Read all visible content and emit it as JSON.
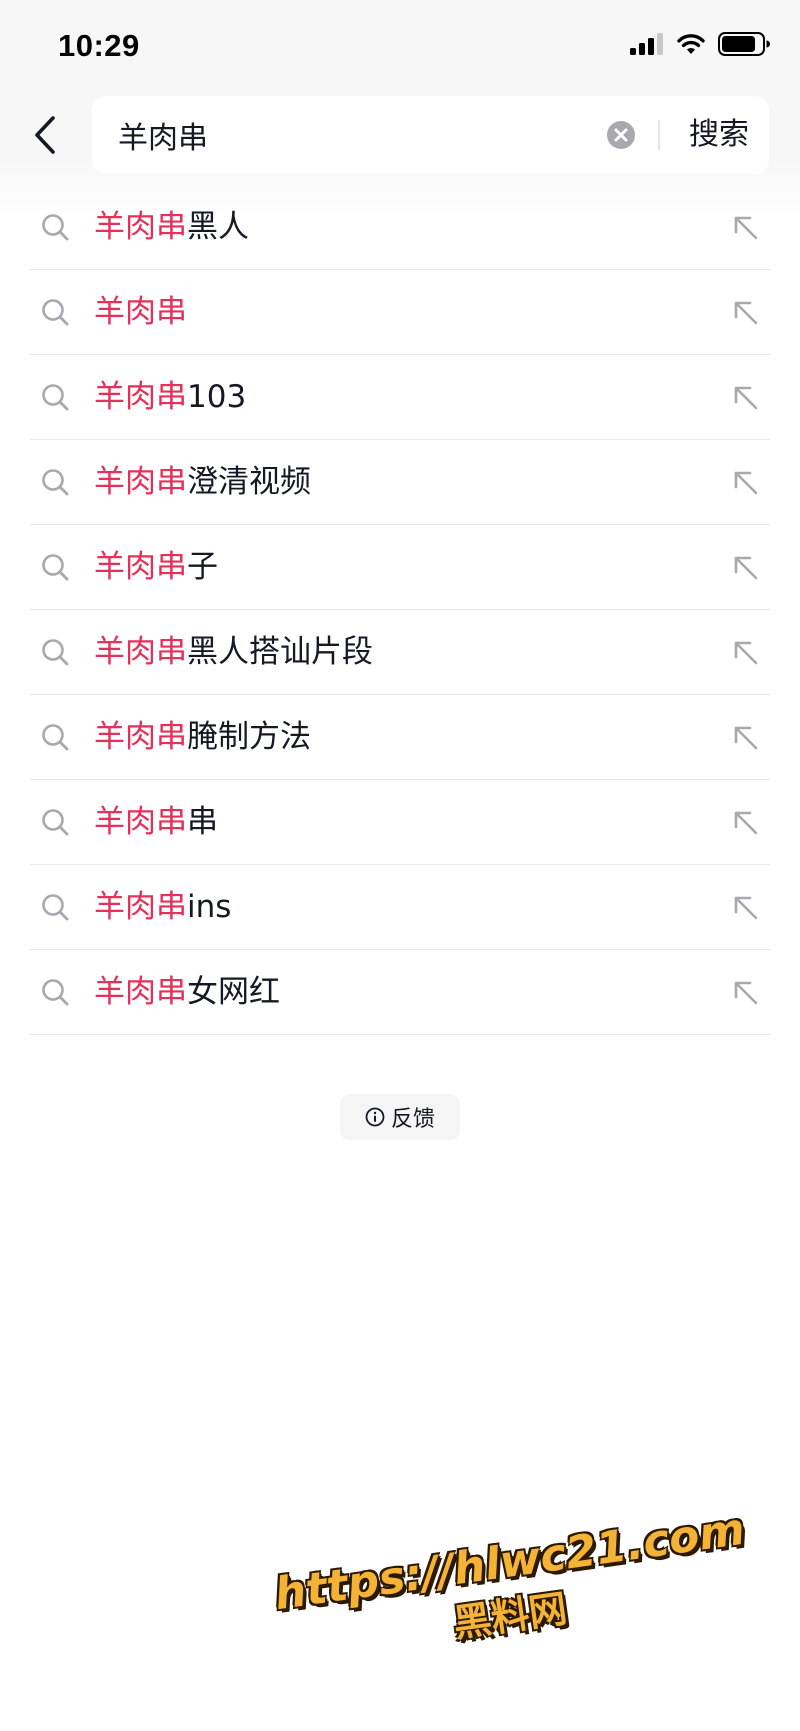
{
  "status_bar": {
    "time": "10:29"
  },
  "search": {
    "value": "羊肉串",
    "search_label": "搜索"
  },
  "suggestions": [
    {
      "highlight": "羊肉串",
      "rest": "黑人"
    },
    {
      "highlight": "羊肉串",
      "rest": ""
    },
    {
      "highlight": "羊肉串",
      "rest": "103"
    },
    {
      "highlight": "羊肉串",
      "rest": "澄清视频"
    },
    {
      "highlight": "羊肉串",
      "rest": "子"
    },
    {
      "highlight": "羊肉串",
      "rest": "黑人搭讪片段"
    },
    {
      "highlight": "羊肉串",
      "rest": "腌制方法"
    },
    {
      "highlight": "羊肉串",
      "rest": "串"
    },
    {
      "highlight": "羊肉串",
      "rest": "ins"
    },
    {
      "highlight": "羊肉串",
      "rest": "女网红"
    }
  ],
  "feedback": {
    "label": "反馈"
  },
  "watermark": {
    "url": "https://hlwc21.com",
    "site": "黑料网"
  },
  "colors": {
    "highlight": "#e6305a",
    "text": "#161823",
    "top_background": "#f7f7f8",
    "watermark": "#f5b335"
  },
  "icons": {
    "back": "chevron-left-icon",
    "clear": "clear-circle-icon",
    "suggestion": "search-icon",
    "fill": "arrow-up-left-icon",
    "feedback": "info-icon",
    "cellular": "cellular-signal-icon",
    "wifi": "wifi-icon",
    "battery": "battery-icon"
  }
}
